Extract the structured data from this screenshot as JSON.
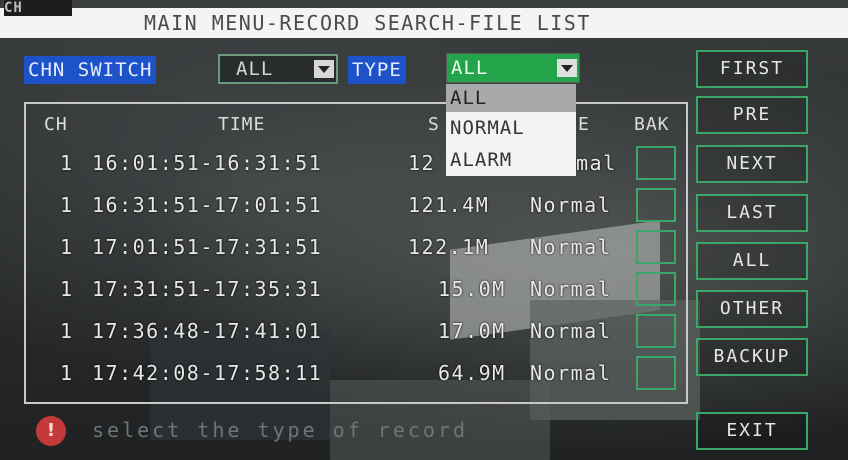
{
  "window": {
    "logo_text": "CH",
    "title": "MAIN MENU-RECORD SEARCH-FILE LIST"
  },
  "filters": {
    "chn_label": "CHN SWITCH",
    "chn_value": "ALL",
    "type_label": "TYPE",
    "type_value": "ALL",
    "type_options": [
      "ALL",
      "NORMAL",
      "ALARM"
    ]
  },
  "table": {
    "headers": {
      "ch": "CH",
      "time": "TIME",
      "size": "S",
      "type": "E",
      "bak": "BAK"
    },
    "rows": [
      {
        "ch": "1",
        "time": "16:01:51-16:31:51",
        "size": "12",
        "type": "mal"
      },
      {
        "ch": "1",
        "time": "16:31:51-17:01:51",
        "size": "121.4M",
        "type": "Normal"
      },
      {
        "ch": "1",
        "time": "17:01:51-17:31:51",
        "size": "122.1M",
        "type": "Normal"
      },
      {
        "ch": "1",
        "time": "17:31:51-17:35:31",
        "size": "15.0M",
        "type": "Normal"
      },
      {
        "ch": "1",
        "time": "17:36:48-17:41:01",
        "size": "17.0M",
        "type": "Normal"
      },
      {
        "ch": "1",
        "time": "17:42:08-17:58:11",
        "size": "64.9M",
        "type": "Normal"
      }
    ]
  },
  "buttons": {
    "first": "FIRST",
    "pre": "PRE",
    "next": "NEXT",
    "last": "LAST",
    "all": "ALL",
    "other": "OTHER",
    "backup": "BACKUP",
    "exit": "EXIT"
  },
  "hint": {
    "text": "select the type of record",
    "icon": "alert-icon"
  },
  "colors": {
    "label_blue": "#1d52c9",
    "type_green": "#23a34a",
    "frame_green": "#3aa66a"
  }
}
